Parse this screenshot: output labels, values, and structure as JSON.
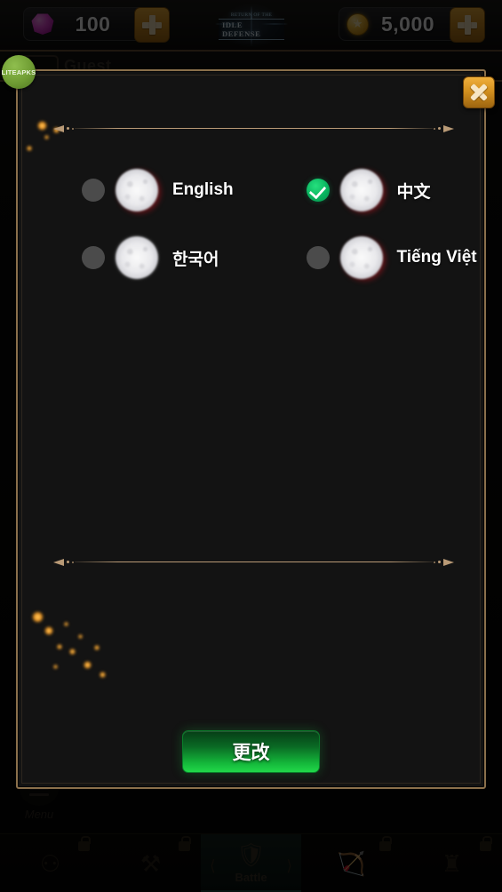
{
  "hud": {
    "gem": {
      "icon": "gem-icon",
      "value": "100",
      "plus": "+"
    },
    "coin": {
      "icon": "coin-icon",
      "value": "5,000",
      "plus": "+"
    },
    "logo": {
      "top_text": "RETURN OF THE",
      "title": "IDLE DEFENSE"
    }
  },
  "watermark": {
    "label": "LITEAPKS"
  },
  "profile": {
    "name": "Guest"
  },
  "menu": {
    "label": "Menu",
    "icon": "hamburger-icon"
  },
  "modal": {
    "close_label": "x",
    "confirm_label": "更改",
    "languages": [
      {
        "name": "English",
        "selected": false,
        "icon": "flag-icon-english"
      },
      {
        "name": "中文",
        "selected": true,
        "icon": "flag-icon-chinese"
      },
      {
        "name": "한국어",
        "selected": false,
        "icon": "flag-icon-korean"
      },
      {
        "name": "Tiếng Việt",
        "selected": false,
        "icon": "flag-icon-vietnamese"
      }
    ]
  },
  "bottom_nav": [
    {
      "label": "",
      "icon": "coins-icon",
      "locked": true,
      "active": false
    },
    {
      "label": "",
      "icon": "anvil-icon",
      "locked": true,
      "active": false
    },
    {
      "label": "Battle",
      "icon": "shield-swords-icon",
      "locked": false,
      "active": true
    },
    {
      "label": "",
      "icon": "ranger-icon",
      "locked": true,
      "active": false
    },
    {
      "label": "",
      "icon": "castle-icon",
      "locked": true,
      "active": false
    }
  ],
  "colors": {
    "accent_gold": "#d3901f",
    "frame_tan": "#8a6f4b",
    "confirm_green": "#14b73a",
    "selected_green": "#09b45f",
    "gem_magenta": "#e84ad8"
  }
}
